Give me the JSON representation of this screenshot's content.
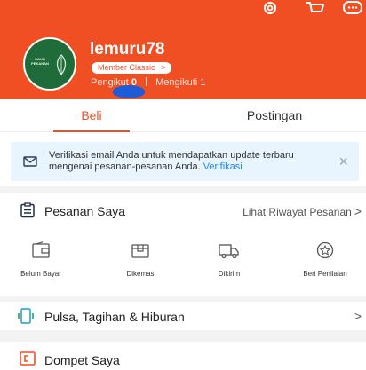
{
  "colors": {
    "accent": "#f04e23",
    "notice_bg": "#e8f4fe",
    "link": "#1e88e5"
  },
  "header": {
    "icons": [
      "gear-icon",
      "cart-icon",
      "chat-icon"
    ],
    "username": "lemuru78",
    "avatar_text": "DAUN PEKANAN",
    "member_badge": "Member Classic",
    "followers_label": "Pengikut",
    "followers_count": "0",
    "following_label": "Mengikuti",
    "following_count": "1"
  },
  "tabs": [
    {
      "label": "Beli",
      "active": true
    },
    {
      "label": "Postingan",
      "active": false
    }
  ],
  "notice": {
    "icon": "mail-icon",
    "text": "Verifikasi email Anda untuk mendapatkan update terbaru mengenai pesanan-pesanan Anda.",
    "link": "Verifikasi"
  },
  "orders": {
    "icon": "clipboard-icon",
    "label": "Pesanan Saya",
    "history_link": "Lihat Riwayat Pesanan",
    "statuses": [
      {
        "label": "Belum Bayar",
        "icon": "wallet-icon"
      },
      {
        "label": "Dikemas",
        "icon": "box-icon"
      },
      {
        "label": "Dikirim",
        "icon": "truck-icon"
      },
      {
        "label": "Beri Penilaian",
        "icon": "star-icon"
      }
    ]
  },
  "pulsa": {
    "icon": "phone-icon",
    "label": "Pulsa, Tagihan & Hiburan"
  },
  "dompet": {
    "icon": "wallet-icon",
    "label": "Dompet Saya"
  }
}
